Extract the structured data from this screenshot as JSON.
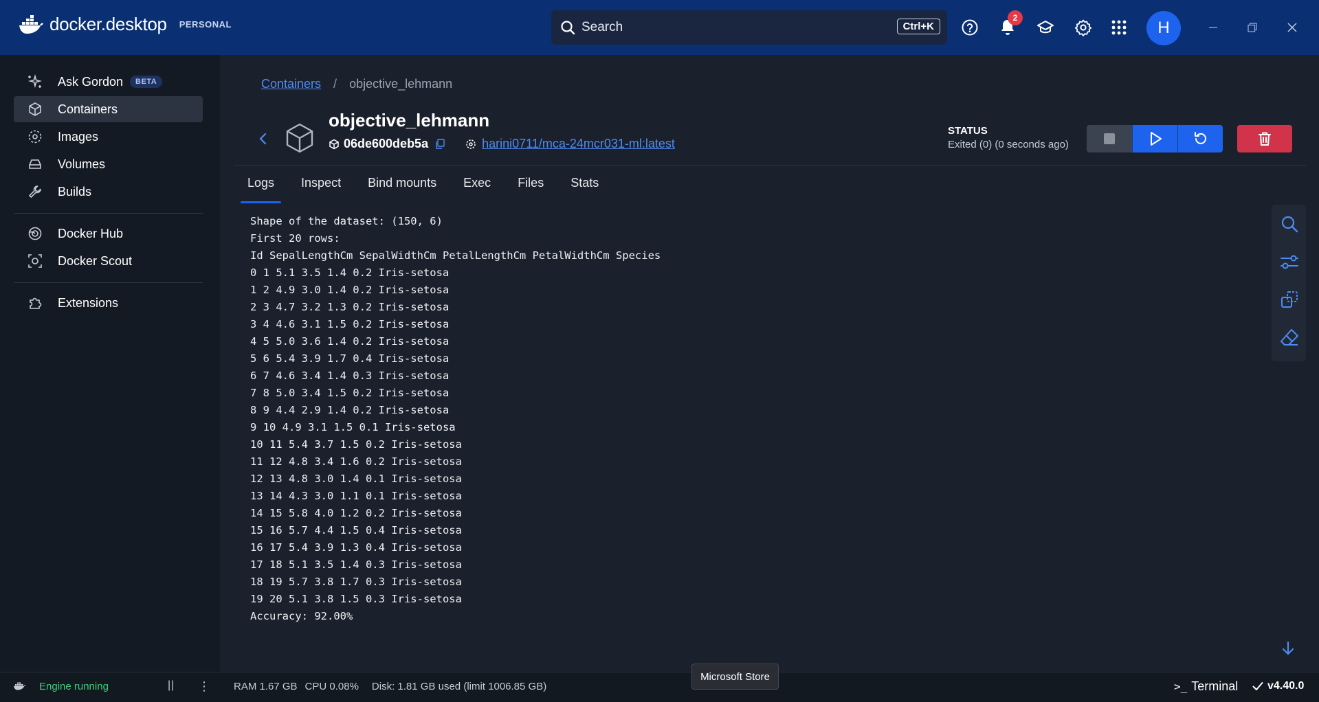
{
  "titlebar": {
    "logo_main": "docker",
    "logo_sub": "desktop",
    "plan_badge": "PERSONAL",
    "search_label": "Search",
    "search_shortcut": "Ctrl+K",
    "notification_count": "2",
    "avatar_initial": "H",
    "icons": [
      "help-icon",
      "bell-icon",
      "learn-icon",
      "settings-icon",
      "apps-grid-icon"
    ]
  },
  "sidebar": {
    "items": [
      {
        "label": "Ask Gordon",
        "badge": "BETA",
        "icon": "gordon-icon"
      },
      {
        "label": "Containers",
        "icon": "container-icon",
        "active": true
      },
      {
        "label": "Images",
        "icon": "images-icon"
      },
      {
        "label": "Volumes",
        "icon": "volume-icon"
      },
      {
        "label": "Builds",
        "icon": "wrench-icon"
      },
      {
        "label": "Docker Hub",
        "icon": "hub-icon"
      },
      {
        "label": "Docker Scout",
        "icon": "scout-icon"
      },
      {
        "label": "Extensions",
        "icon": "puzzle-icon"
      }
    ]
  },
  "breadcrumb": {
    "parent": "Containers",
    "separator": "/",
    "current": "objective_lehmann"
  },
  "container": {
    "name": "objective_lehmann",
    "id": "06de600deb5a",
    "image": "harini0711/mca-24mcr031-ml:latest",
    "status_title": "STATUS",
    "status_value": "Exited (0) (0 seconds ago)"
  },
  "tabs": [
    "Logs",
    "Inspect",
    "Bind mounts",
    "Exec",
    "Files",
    "Stats"
  ],
  "active_tab": "Logs",
  "logs": [
    "Shape of the dataset: (150, 6)",
    "First 20 rows:",
    "Id SepalLengthCm SepalWidthCm PetalLengthCm PetalWidthCm Species",
    "0 1 5.1 3.5 1.4 0.2 Iris-setosa",
    "1 2 4.9 3.0 1.4 0.2 Iris-setosa",
    "2 3 4.7 3.2 1.3 0.2 Iris-setosa",
    "3 4 4.6 3.1 1.5 0.2 Iris-setosa",
    "4 5 5.0 3.6 1.4 0.2 Iris-setosa",
    "5 6 5.4 3.9 1.7 0.4 Iris-setosa",
    "6 7 4.6 3.4 1.4 0.3 Iris-setosa",
    "7 8 5.0 3.4 1.5 0.2 Iris-setosa",
    "8 9 4.4 2.9 1.4 0.2 Iris-setosa",
    "9 10 4.9 3.1 1.5 0.1 Iris-setosa",
    "10 11 5.4 3.7 1.5 0.2 Iris-setosa",
    "11 12 4.8 3.4 1.6 0.2 Iris-setosa",
    "12 13 4.8 3.0 1.4 0.1 Iris-setosa",
    "13 14 4.3 3.0 1.1 0.1 Iris-setosa",
    "14 15 5.8 4.0 1.2 0.2 Iris-setosa",
    "15 16 5.7 4.4 1.5 0.4 Iris-setosa",
    "16 17 5.4 3.9 1.3 0.4 Iris-setosa",
    "17 18 5.1 3.5 1.4 0.3 Iris-setosa",
    "18 19 5.7 3.8 1.7 0.3 Iris-setosa",
    "19 20 5.1 3.8 1.5 0.3 Iris-setosa",
    "Accuracy: 92.00%"
  ],
  "footer": {
    "engine_status": "Engine running",
    "pause_symbol": "||",
    "more_symbol": "⋮",
    "ram": "RAM 1.67 GB",
    "cpu": "CPU 0.08%",
    "disk": "Disk: 1.81 GB used (limit 1006.85 GB)",
    "terminal_label": "Terminal",
    "version": "v4.40.0"
  },
  "tooltip": "Microsoft Store",
  "colors": {
    "titlebar": "#0a3073",
    "accent": "#1d63ed",
    "danger": "#d1344a",
    "engine_ok": "#3ccf78"
  }
}
